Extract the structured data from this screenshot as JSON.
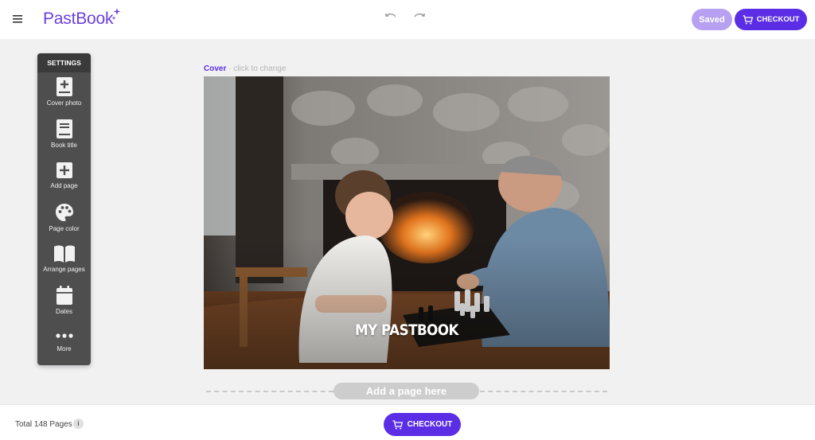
{
  "header": {
    "logo_text": "PastBook",
    "menu_icon": "hamburger-menu-icon",
    "saved_label": "Saved",
    "checkout_label": "CHECKOUT"
  },
  "settings": {
    "title": "SETTINGS",
    "items": [
      {
        "label": "Cover photo",
        "icon": "cover-photo-icon"
      },
      {
        "label": "Book title",
        "icon": "book-title-icon"
      },
      {
        "label": "Add page",
        "icon": "add-page-icon"
      },
      {
        "label": "Page color",
        "icon": "palette-icon"
      },
      {
        "label": "Arrange pages",
        "icon": "open-book-icon"
      },
      {
        "label": "Dates",
        "icon": "calendar-icon"
      },
      {
        "label": "More",
        "icon": "more-dots-icon"
      }
    ]
  },
  "cover": {
    "label": "Cover",
    "hint": " · click to change",
    "title": "MY PASTBOOK"
  },
  "add_page": {
    "label": "Add a page here"
  },
  "footer": {
    "total_pages": "Total 148 Pages",
    "info": "i",
    "checkout_label": "CHECKOUT"
  },
  "colors": {
    "brand": "#5b2ee5",
    "brand_light": "#b7a0f2",
    "panel": "#4e4e4e",
    "background": "#f1f1f2"
  }
}
